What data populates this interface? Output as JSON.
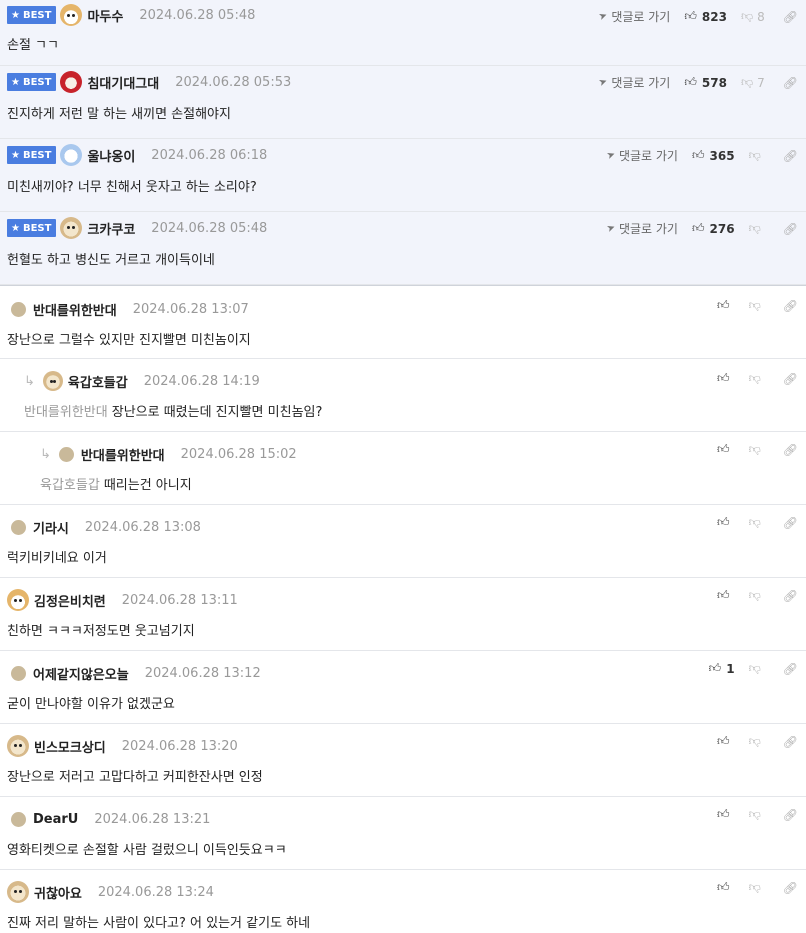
{
  "best_badge": "BEST",
  "goto_label": "댓글로 가기",
  "comments": [
    {
      "nick": "마두수",
      "date": "2024.06.28 05:48",
      "text": "손절 ㄱㄱ",
      "up": "823",
      "down": "8"
    },
    {
      "nick": "침대기대그대",
      "date": "2024.06.28 05:53",
      "text": "진지하게 저런 말 하는 새끼면 손절해야지",
      "up": "578",
      "down": "7"
    },
    {
      "nick": "울냐옹이",
      "date": "2024.06.28 06:18",
      "text": "미친새끼야? 너무 친해서 웃자고 하는 소리야?",
      "up": "365",
      "down": ""
    },
    {
      "nick": "크카쿠코",
      "date": "2024.06.28 05:48",
      "text": "헌혈도 하고 병신도 거르고 개이득이네",
      "up": "276",
      "down": ""
    },
    {
      "nick": "반대를위한반대",
      "date": "2024.06.28 13:07",
      "text": "장난으로 그럴수 있지만 진지빨면 미친놈이지",
      "up": "",
      "down": ""
    },
    {
      "nick": "육갑호들갑",
      "date": "2024.06.28 14:19",
      "mention": "반대를위한반대",
      "text": "장난으로 때렸는데 진지빨면 미친놈임?",
      "up": "",
      "down": ""
    },
    {
      "nick": "반대를위한반대",
      "date": "2024.06.28 15:02",
      "mention": "육갑호들갑",
      "text": "때리는건 아니지",
      "up": "",
      "down": ""
    },
    {
      "nick": "기라시",
      "date": "2024.06.28 13:08",
      "text": "럭키비키네요 이거",
      "up": "",
      "down": ""
    },
    {
      "nick": "김정은비치련",
      "date": "2024.06.28 13:11",
      "text": "친하면 ㅋㅋㅋ저정도면 웃고넘기지",
      "up": "",
      "down": ""
    },
    {
      "nick": "어제같지않은오늘",
      "date": "2024.06.28 13:12",
      "text": "굳이 만나야할 이유가 없겠군요",
      "up": "1",
      "down": ""
    },
    {
      "nick": "빈스모크상디",
      "date": "2024.06.28 13:20",
      "text": "장난으로 저러고 고맙다하고 커피한잔사면 인정",
      "up": "",
      "down": ""
    },
    {
      "nick": "DearU",
      "date": "2024.06.28 13:21",
      "text": "영화티켓으로 손절할 사람 걸렀으니 이득인듯요ㅋㅋ",
      "up": "",
      "down": ""
    },
    {
      "nick": "귀찮아요",
      "date": "2024.06.28 13:24",
      "text": "진짜 저리 말하는 사람이 있다고? 어 있는거 같기도 하네",
      "up": "",
      "down": ""
    }
  ]
}
